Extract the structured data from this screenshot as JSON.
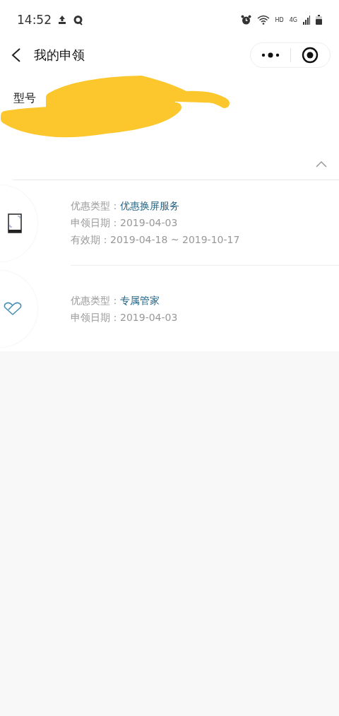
{
  "status_bar": {
    "time": "14:52",
    "network_label": "HD",
    "network_type": "4G"
  },
  "header": {
    "title": "我的申领"
  },
  "model": {
    "label": "型号"
  },
  "section": {
    "expanded": true
  },
  "items": [
    {
      "kind": "phone",
      "lines": [
        {
          "kind": "type",
          "label": "优惠类型：",
          "value": "优惠换屏服务"
        },
        {
          "kind": "plain",
          "label": "申领日期：",
          "value": "2019-04-03"
        },
        {
          "kind": "plain",
          "label": "有效期：",
          "value": "2019-04-18 ~ 2019-10-17"
        }
      ]
    },
    {
      "kind": "heart",
      "lines": [
        {
          "kind": "type",
          "label": "优惠类型：",
          "value": "专属管家"
        },
        {
          "kind": "plain",
          "label": "申领日期：",
          "value": "2019-04-03"
        }
      ]
    }
  ]
}
